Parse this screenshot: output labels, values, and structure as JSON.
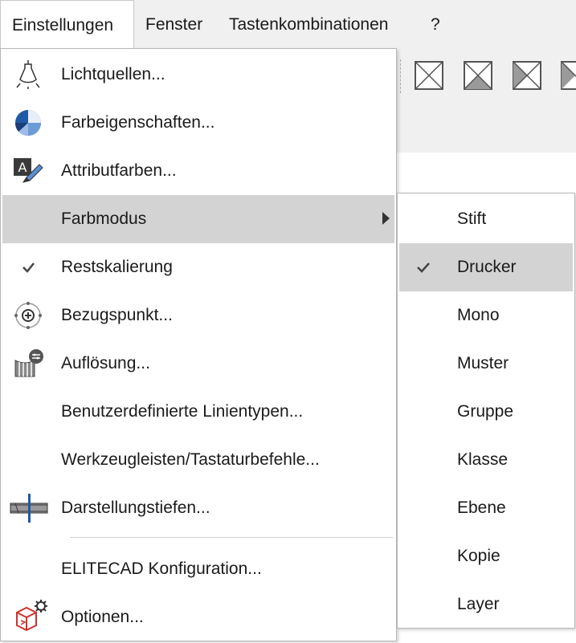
{
  "menubar": {
    "items": [
      "Einstellungen",
      "Fenster",
      "Tastenkombinationen",
      "?"
    ]
  },
  "menu": {
    "items": [
      {
        "label": "Lichtquellen...",
        "icon": "light-bulb-icon"
      },
      {
        "label": "Farbeigenschaften...",
        "icon": "color-wheel-icon"
      },
      {
        "label": "Attributfarben...",
        "icon": "text-pencil-icon"
      },
      {
        "label": "Farbmodus",
        "icon": "",
        "submenu": true
      },
      {
        "label": "Restskalierung",
        "icon": "checkmark-icon",
        "checked": true
      },
      {
        "label": "Bezugspunkt...",
        "icon": "reference-point-icon"
      },
      {
        "label": "Auflösung...",
        "icon": "resolution-icon"
      },
      {
        "label": "Benutzerdefinierte Linientypen...",
        "icon": ""
      },
      {
        "label": "Werkzeugleisten/Tastaturbefehle...",
        "icon": ""
      },
      {
        "label": "Darstellungstiefen...",
        "icon": "depth-layers-icon"
      },
      {
        "label": "ELITECAD Konfiguration...",
        "icon": ""
      },
      {
        "label": "Optionen...",
        "icon": "options-cube-gear-icon"
      }
    ]
  },
  "submenu": {
    "items": [
      {
        "label": "Stift"
      },
      {
        "label": "Drucker",
        "checked": true
      },
      {
        "label": "Mono"
      },
      {
        "label": "Muster"
      },
      {
        "label": "Gruppe"
      },
      {
        "label": "Klasse"
      },
      {
        "label": "Ebene"
      },
      {
        "label": "Kopie"
      },
      {
        "label": "Layer"
      }
    ]
  },
  "colors": {
    "menubar_bg": "#f0f0f0",
    "highlight": "#d3d3d3",
    "accent_blue": "#1e5aa8"
  }
}
